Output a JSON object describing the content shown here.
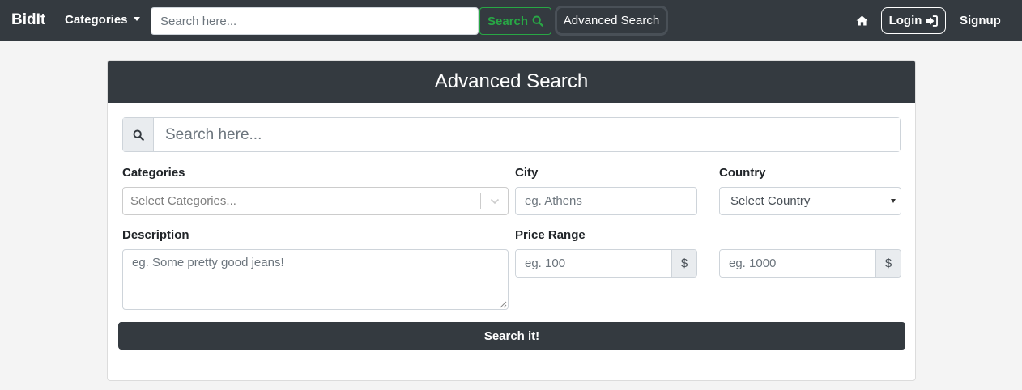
{
  "navbar": {
    "brand": "BidIt",
    "categories_label": "Categories",
    "search_placeholder": "Search here...",
    "search_button": "Search",
    "advanced_search_button": "Advanced Search",
    "login_button": "Login",
    "signup_link": "Signup"
  },
  "card": {
    "title": "Advanced Search",
    "search_placeholder": "Search here...",
    "categories_label": "Categories",
    "categories_placeholder": "Select Categories...",
    "city_label": "City",
    "city_placeholder": "eg. Athens",
    "country_label": "Country",
    "country_selected": "Select Country",
    "description_label": "Description",
    "description_placeholder": "eg. Some pretty good jeans!",
    "price_label": "Price Range",
    "price_min_placeholder": "eg. 100",
    "price_max_placeholder": "eg. 1000",
    "currency_symbol": "$",
    "submit_button": "Search it!"
  },
  "colors": {
    "navbar_bg": "#343a40",
    "accent_green": "#28a745",
    "page_bg": "#f4f4f4"
  },
  "icons": [
    "search-icon",
    "home-icon",
    "sign-in-icon",
    "chevron-down-icon"
  ]
}
